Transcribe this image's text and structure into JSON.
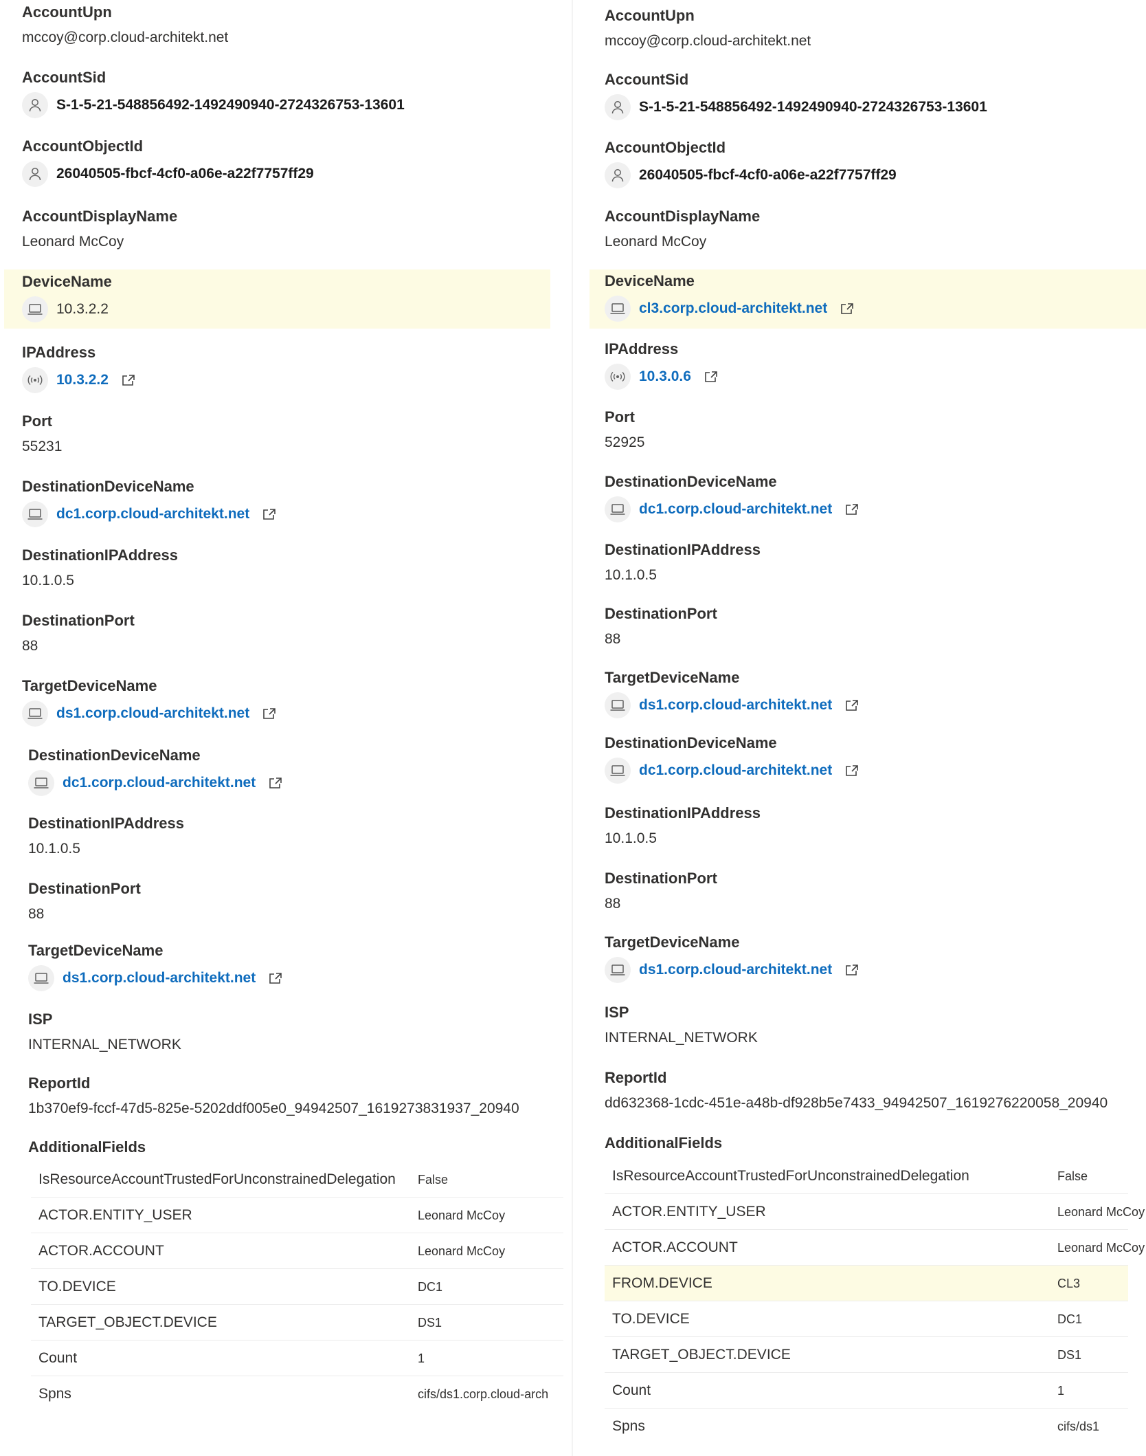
{
  "left": {
    "account_upn": {
      "label": "AccountUpn",
      "value": "mccoy@corp.cloud-architekt.net"
    },
    "account_sid": {
      "label": "AccountSid",
      "value": "S-1-5-21-548856492-1492490940-2724326753-13601"
    },
    "account_object_id": {
      "label": "AccountObjectId",
      "value": "26040505-fbcf-4cf0-a06e-a22f7757ff29"
    },
    "account_display_name": {
      "label": "AccountDisplayName",
      "value": "Leonard McCoy"
    },
    "device_name": {
      "label": "DeviceName",
      "value": "10.3.2.2"
    },
    "ip_address": {
      "label": "IPAddress",
      "value": "10.3.2.2"
    },
    "port": {
      "label": "Port",
      "value": "55231"
    },
    "dest_device_name_1": {
      "label": "DestinationDeviceName",
      "value": "dc1.corp.cloud-architekt.net"
    },
    "dest_ip_1": {
      "label": "DestinationIPAddress",
      "value": "10.1.0.5"
    },
    "dest_port_1": {
      "label": "DestinationPort",
      "value": "88"
    },
    "target_device_1": {
      "label": "TargetDeviceName",
      "value": "ds1.corp.cloud-architekt.net"
    },
    "dest_device_name_2": {
      "label": "DestinationDeviceName",
      "value": "dc1.corp.cloud-architekt.net"
    },
    "dest_ip_2": {
      "label": "DestinationIPAddress",
      "value": "10.1.0.5"
    },
    "dest_port_2": {
      "label": "DestinationPort",
      "value": "88"
    },
    "target_device_2": {
      "label": "TargetDeviceName",
      "value": "ds1.corp.cloud-architekt.net"
    },
    "isp": {
      "label": "ISP",
      "value": "INTERNAL_NETWORK"
    },
    "report_id": {
      "label": "ReportId",
      "value": "1b370ef9-fccf-47d5-825e-5202ddf005e0_94942507_1619273831937_20940"
    },
    "additional_fields": {
      "label": "AdditionalFields",
      "rows": [
        {
          "key": "IsResourceAccountTrustedForUnconstrainedDelegation",
          "value": "False"
        },
        {
          "key": "ACTOR.ENTITY_USER",
          "value": "Leonard McCoy"
        },
        {
          "key": "ACTOR.ACCOUNT",
          "value": "Leonard McCoy"
        },
        {
          "key": "TO.DEVICE",
          "value": "DC1"
        },
        {
          "key": "TARGET_OBJECT.DEVICE",
          "value": "DS1"
        },
        {
          "key": "Count",
          "value": "1"
        },
        {
          "key": "Spns",
          "value": "cifs/ds1.corp.cloud-arch"
        }
      ]
    }
  },
  "right": {
    "account_upn": {
      "label": "AccountUpn",
      "value": "mccoy@corp.cloud-architekt.net"
    },
    "account_sid": {
      "label": "AccountSid",
      "value": "S-1-5-21-548856492-1492490940-2724326753-13601"
    },
    "account_object_id": {
      "label": "AccountObjectId",
      "value": "26040505-fbcf-4cf0-a06e-a22f7757ff29"
    },
    "account_display_name": {
      "label": "AccountDisplayName",
      "value": "Leonard McCoy"
    },
    "device_name": {
      "label": "DeviceName",
      "value": "cl3.corp.cloud-architekt.net"
    },
    "ip_address": {
      "label": "IPAddress",
      "value": "10.3.0.6"
    },
    "port": {
      "label": "Port",
      "value": "52925"
    },
    "dest_device_name_1": {
      "label": "DestinationDeviceName",
      "value": "dc1.corp.cloud-architekt.net"
    },
    "dest_ip_1": {
      "label": "DestinationIPAddress",
      "value": "10.1.0.5"
    },
    "dest_port_1": {
      "label": "DestinationPort",
      "value": "88"
    },
    "target_device_1": {
      "label": "TargetDeviceName",
      "value": "ds1.corp.cloud-architekt.net"
    },
    "dest_device_name_2": {
      "label": "DestinationDeviceName",
      "value": "dc1.corp.cloud-architekt.net"
    },
    "dest_ip_2": {
      "label": "DestinationIPAddress",
      "value": "10.1.0.5"
    },
    "dest_port_2": {
      "label": "DestinationPort",
      "value": "88"
    },
    "target_device_2": {
      "label": "TargetDeviceName",
      "value": "ds1.corp.cloud-architekt.net"
    },
    "isp": {
      "label": "ISP",
      "value": "INTERNAL_NETWORK"
    },
    "report_id": {
      "label": "ReportId",
      "value": "dd632368-1cdc-451e-a48b-df928b5e7433_94942507_1619276220058_20940"
    },
    "additional_fields": {
      "label": "AdditionalFields",
      "rows": [
        {
          "key": "IsResourceAccountTrustedForUnconstrainedDelegation",
          "value": "False"
        },
        {
          "key": "ACTOR.ENTITY_USER",
          "value": "Leonard McCoy"
        },
        {
          "key": "ACTOR.ACCOUNT",
          "value": "Leonard McCoy"
        },
        {
          "key": "FROM.DEVICE",
          "value": "CL3"
        },
        {
          "key": "TO.DEVICE",
          "value": "DC1"
        },
        {
          "key": "TARGET_OBJECT.DEVICE",
          "value": "DS1"
        },
        {
          "key": "Count",
          "value": "1"
        },
        {
          "key": "Spns",
          "value": "cifs/ds1"
        }
      ]
    }
  },
  "icons": {
    "person": "person-icon",
    "laptop": "laptop-icon",
    "broadcast": "network-broadcast-icon",
    "external": "external-link-icon"
  },
  "colors": {
    "highlight": "#fdfbe3",
    "link": "#0f6cbd",
    "text": "#323130"
  }
}
